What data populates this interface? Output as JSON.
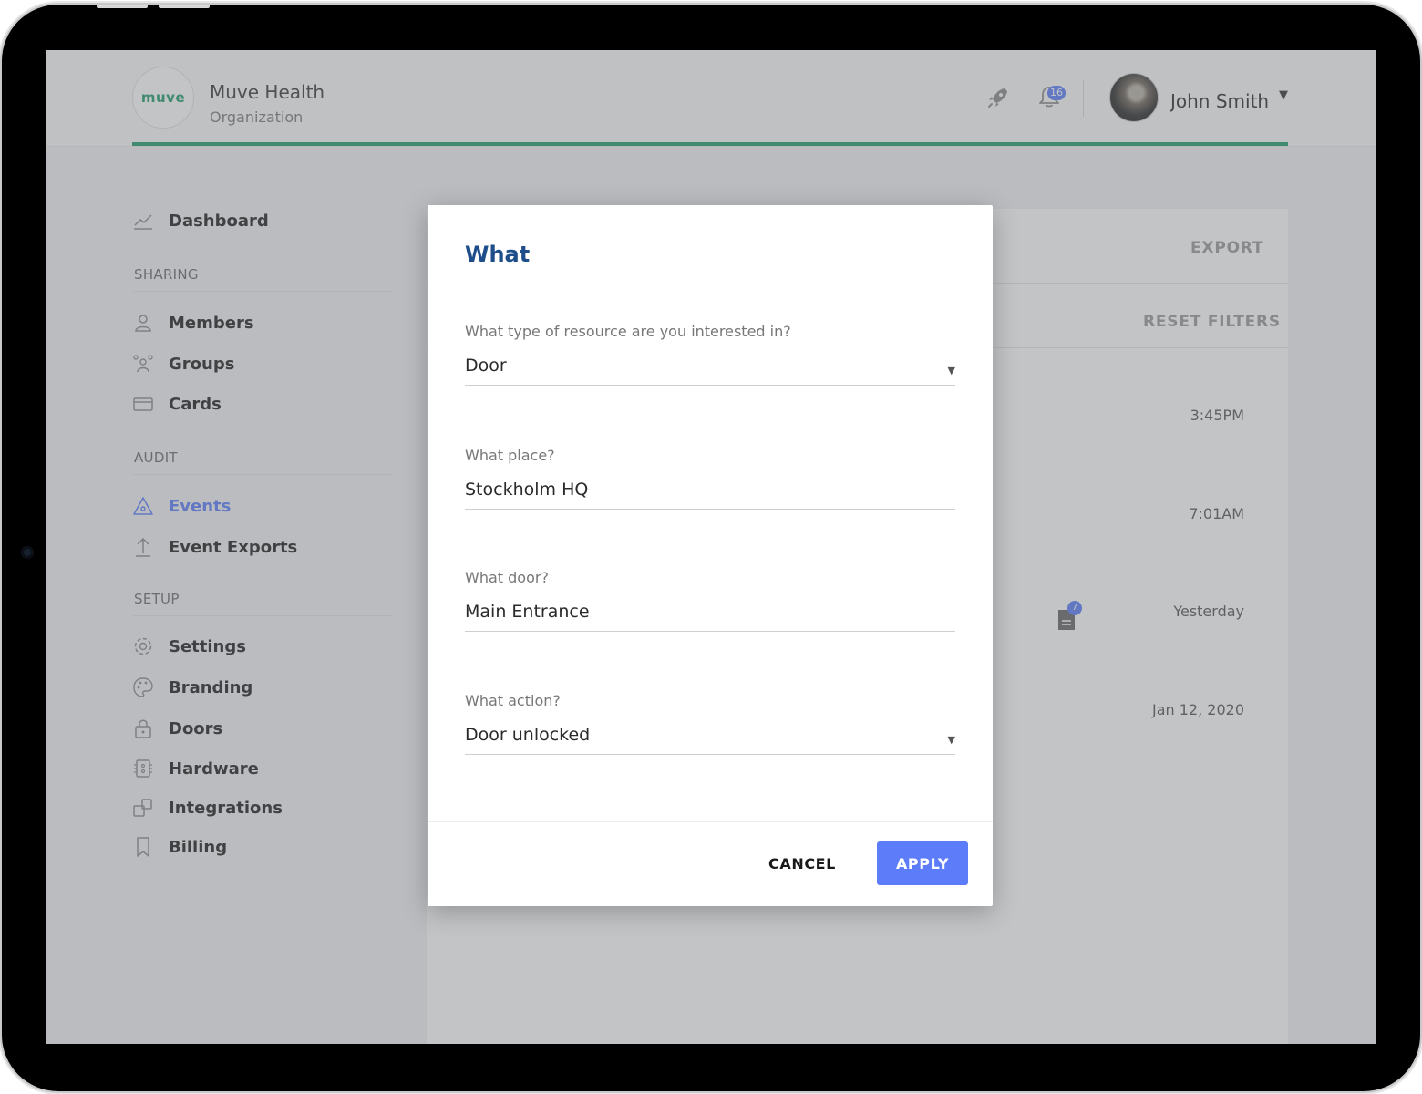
{
  "header": {
    "logo_text": "muve",
    "org_name": "Muve Health",
    "org_subtitle": "Organization",
    "notifications_count": "16",
    "user_name": "John Smith",
    "accent_color": "#1f9e6a"
  },
  "sidebar": {
    "dashboard": "Dashboard",
    "sections": {
      "sharing": "SHARING",
      "audit": "AUDIT",
      "setup": "SETUP"
    },
    "items": {
      "members": "Members",
      "groups": "Groups",
      "cards": "Cards",
      "events": "Events",
      "event_exports": "Event Exports",
      "settings": "Settings",
      "branding": "Branding",
      "doors": "Doors",
      "hardware": "Hardware",
      "integrations": "Integrations",
      "billing": "Billing"
    },
    "active_item": "events"
  },
  "background": {
    "export_label": "EXPORT",
    "reset_filters_label": "RESET FILTERS",
    "times": [
      "3:45PM",
      "7:01AM",
      "Yesterday",
      "Jan 12, 2020"
    ],
    "doc_badge": "7"
  },
  "modal": {
    "title": "What",
    "fields": [
      {
        "label": "What type of resource are you interested in?",
        "value": "Door",
        "dropdown": true
      },
      {
        "label": "What place?",
        "value": "Stockholm HQ",
        "dropdown": false
      },
      {
        "label": "What door?",
        "value": "Main Entrance",
        "dropdown": false
      },
      {
        "label": "What action?",
        "value": "Door unlocked",
        "dropdown": true
      }
    ],
    "cancel_label": "CANCEL",
    "apply_label": "APPLY",
    "primary_color": "#5c7cfa",
    "title_color": "#1d4e89"
  }
}
